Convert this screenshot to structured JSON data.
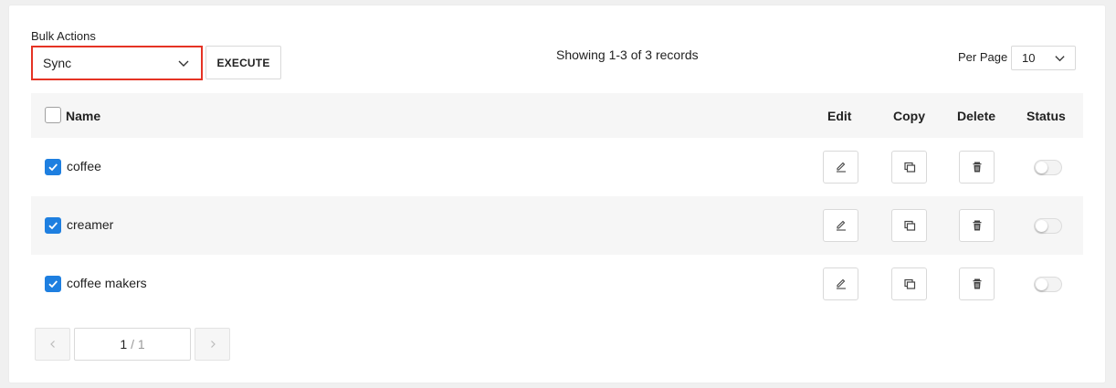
{
  "toolbar": {
    "bulk_label": "Bulk Actions",
    "bulk_value": "Sync",
    "execute_label": "EXECUTE",
    "showing_text": "Showing 1-3 of 3 records",
    "per_page_label": "Per Page",
    "per_page_value": "10"
  },
  "table": {
    "headers": {
      "name": "Name",
      "edit": "Edit",
      "copy": "Copy",
      "delete": "Delete",
      "status": "Status"
    },
    "select_all_checked": false,
    "rows": [
      {
        "name": "coffee",
        "checked": true,
        "status_on": false
      },
      {
        "name": "creamer",
        "checked": true,
        "status_on": false
      },
      {
        "name": "coffee makers",
        "checked": true,
        "status_on": false
      }
    ]
  },
  "pagination": {
    "current": "1",
    "total_text": "/ 1",
    "prev_icon": "chevron-left-icon",
    "next_icon": "chevron-right-icon"
  },
  "colors": {
    "checkbox_checked": "#1e7fe0",
    "highlight_border": "#e53324",
    "row_alt_bg": "#f6f6f6"
  }
}
